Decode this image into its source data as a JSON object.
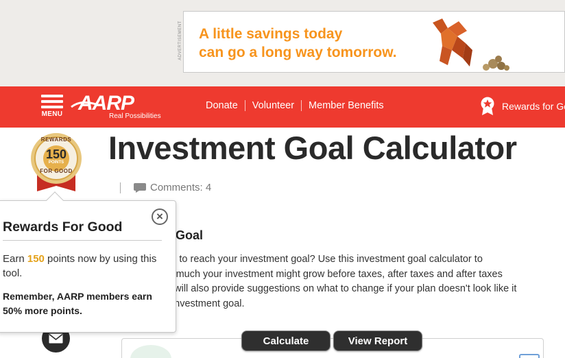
{
  "ad": {
    "label": "ADVERTISEMENT",
    "headline_line1": "A little savings today",
    "headline_line2": "can go a long way tomorrow.",
    "headline_color": "#f7941d"
  },
  "nav": {
    "menu_label": "MENU",
    "logo_text": "AARP",
    "logo_tagline": "Real Possibilities",
    "links": [
      "Donate",
      "Volunteer",
      "Member Benefits"
    ],
    "rewards_label": "Rewards for Good",
    "background_color": "#ee3a2f"
  },
  "badge": {
    "top_text": "REWARDS",
    "points": "150",
    "points_unit": "POINTS",
    "bottom_text": "FOR GOOD"
  },
  "page": {
    "title": "Investment Goal Calculator",
    "comments_label": "Comments: 4",
    "section_heading": "nt Goal",
    "intro_lines": [
      "ake to reach your investment goal? Use this investment goal calculator to",
      "ow much your investment might grow before taxes, after taxes and after taxes",
      ". It will also provide suggestions on what to change if your plan doesn't look like it",
      "ur investment goal."
    ]
  },
  "popover": {
    "title": "Rewards For Good",
    "earn_prefix": "Earn ",
    "earn_points": "150",
    "earn_suffix": " points now by using this tool.",
    "member_note": "Remember, AARP members earn 50% more points.",
    "close_icon": "close-icon"
  },
  "actions": {
    "calculate_label": "Calculate",
    "view_report_label": "View Report",
    "mail_icon": "mail-icon"
  }
}
